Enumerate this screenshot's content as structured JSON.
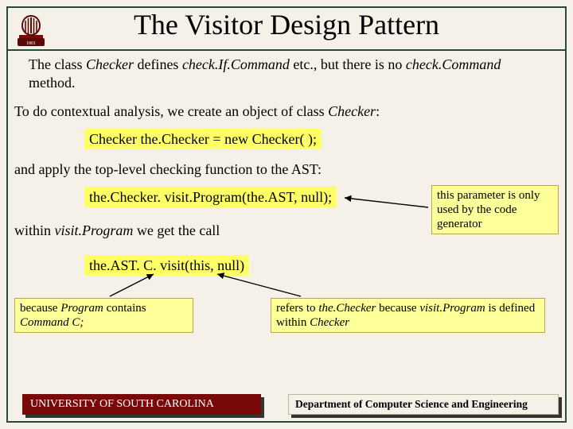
{
  "title": "The Visitor Design Pattern",
  "p1_a": "The class ",
  "p1_b": "Checker",
  "p1_c": " defines ",
  "p1_d": "check.If.Command",
  "p1_e": " etc., but there is no ",
  "p1_f": "check.Command",
  "p1_g": " method.",
  "p2_a": "To do contextual analysis, we create an object of class ",
  "p2_b": "Checker",
  "p2_c": ":",
  "code1": "Checker the.Checker = new Checker( );",
  "p3": "and apply the top-level checking function to the AST:",
  "code2": "the.Checker. visit.Program(the.AST, null);",
  "sidebox": "this parameter is only used by the code generator",
  "p4_a": "within ",
  "p4_b": "visit.Program",
  "p4_c": " we get the call",
  "code3": "the.AST. C. visit(this, null)",
  "boxL_a": "because ",
  "boxL_b": "Program",
  "boxL_c": " contains ",
  "boxL_d": "Command C;",
  "boxR_a": "refers to ",
  "boxR_b": "the.Checker",
  "boxR_c": " because ",
  "boxR_d": "visit.Program",
  "boxR_e": " is defined within ",
  "boxR_f": "Checker",
  "footerL": "UNIVERSITY OF SOUTH CAROLINA",
  "footerR": "Department of Computer Science and Engineering"
}
